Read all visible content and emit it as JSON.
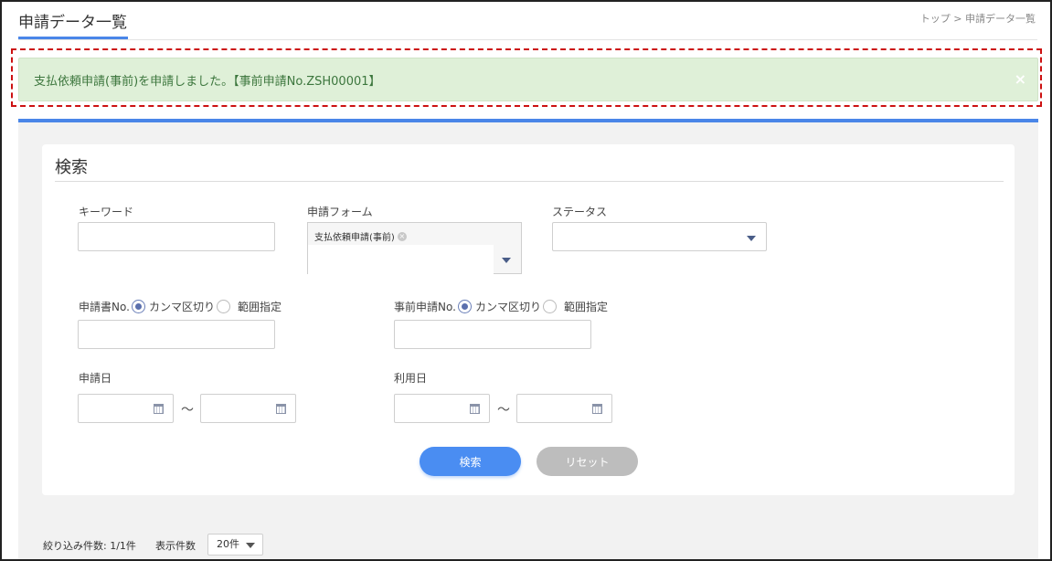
{
  "header": {
    "title": "申請データ一覧",
    "breadcrumb": "トップ > 申請データ一覧"
  },
  "alert": {
    "message": "支払依頼申請(事前)を申請しました。【事前申請No.ZSH00001】",
    "close_icon": "×"
  },
  "search": {
    "heading": "検索",
    "keyword_label": "キーワード",
    "keyword_value": "",
    "form_label": "申請フォーム",
    "form_tags": [
      "支払依頼申請(事前)"
    ],
    "status_label": "ステータス",
    "status_value": "",
    "app_no_label": "申請書No.",
    "app_no_mode_comma": "カンマ区切り",
    "app_no_mode_range": "範囲指定",
    "app_no_value": "",
    "pre_app_no_label": "事前申請No.",
    "pre_app_no_mode_comma": "カンマ区切り",
    "pre_app_no_mode_range": "範囲指定",
    "pre_app_no_value": "",
    "apply_date_label": "申請日",
    "use_date_label": "利用日",
    "range_sep": "～",
    "search_button": "検索",
    "reset_button": "リセット"
  },
  "footer": {
    "count_text": "絞り込み件数: 1/1件",
    "page_size_label": "表示件数",
    "page_size_value": "20件"
  },
  "colors": {
    "accent": "#4a86e8",
    "alert_bg": "#dff0d8",
    "alert_text": "#3c763d",
    "search_button": "#4a8df2",
    "reset_button": "#bdbdbd",
    "highlight_border": "#cc1111"
  }
}
